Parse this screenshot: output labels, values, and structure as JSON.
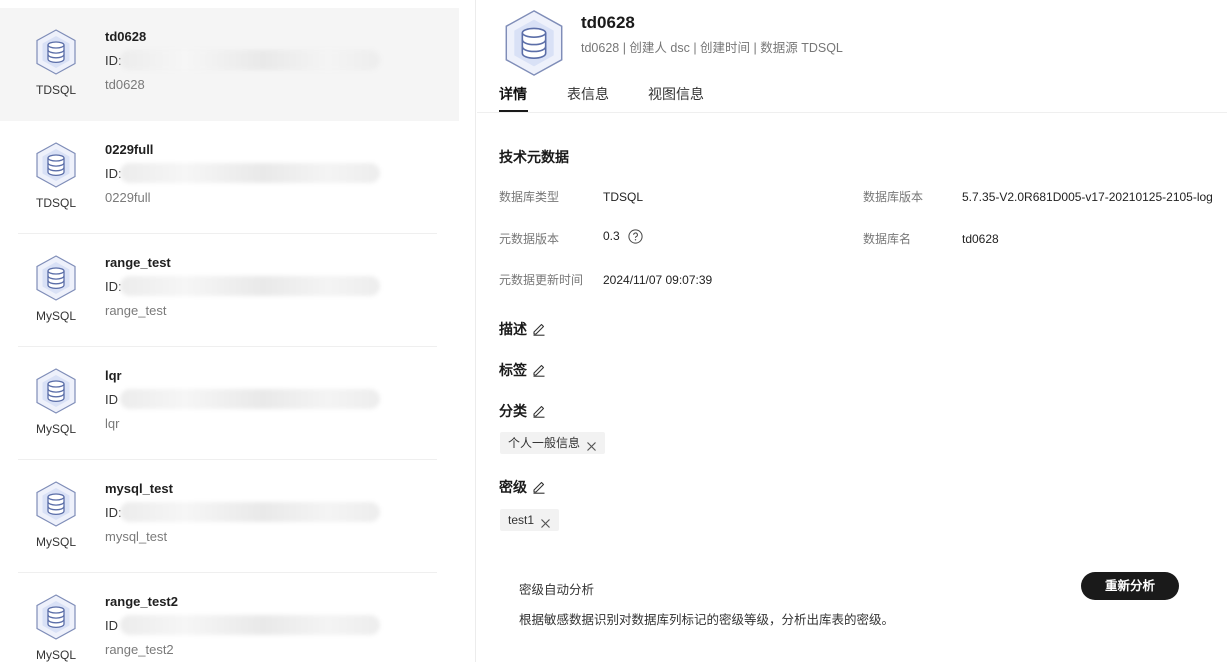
{
  "colors": {
    "icon_fill": "#c9d3f2",
    "icon_stroke": "#5b6ea8",
    "selected_bg": "#f5f5f5",
    "button_bg": "#1a1a1a"
  },
  "db_list": [
    {
      "name": "td0628",
      "type": "TDSQL",
      "id_label": "ID:",
      "sub": "td0628",
      "selected": true
    },
    {
      "name": "0229full",
      "type": "TDSQL",
      "id_label": "ID:",
      "sub": "0229full",
      "selected": false
    },
    {
      "name": "range_test",
      "type": "MySQL",
      "id_label": "ID:",
      "sub": "range_test",
      "selected": false
    },
    {
      "name": "lqr",
      "type": "MySQL",
      "id_label": "ID",
      "sub": "lqr",
      "selected": false
    },
    {
      "name": "mysql_test",
      "type": "MySQL",
      "id_label": "ID:",
      "sub": "mysql_test",
      "selected": false
    },
    {
      "name": "range_test2",
      "type": "MySQL",
      "id_label": "ID",
      "sub": "range_test2",
      "selected": false
    }
  ],
  "detail": {
    "title": "td0628",
    "meta": "td0628 | 创建人 dsc | 创建时间  | 数据源 TDSQL",
    "tabs": [
      {
        "label": "详情",
        "active": true
      },
      {
        "label": "表信息",
        "active": false
      },
      {
        "label": "视图信息",
        "active": false
      }
    ],
    "tech_meta": {
      "title": "技术元数据",
      "db_type_label": "数据库类型",
      "db_type_value": "TDSQL",
      "db_version_label": "数据库版本",
      "db_version_value": "5.7.35-V2.0R681D005-v17-20210125-2105-log",
      "meta_version_label": "元数据版本",
      "meta_version_value": "0.3",
      "db_name_label": "数据库名",
      "db_name_value": "td0628",
      "update_time_label": "元数据更新时间",
      "update_time_value": "2024/11/07 09:07:39"
    },
    "description_title": "描述",
    "tags_title": "标签",
    "category_title": "分类",
    "category_tags": [
      "个人一般信息"
    ],
    "security_title": "密级",
    "security_tags": [
      "test1"
    ],
    "auto_analysis": {
      "title": "密级自动分析",
      "description": "根据敏感数据识别对数据库列标记的密级等级，分析出库表的密级。",
      "button": "重新分析"
    }
  }
}
